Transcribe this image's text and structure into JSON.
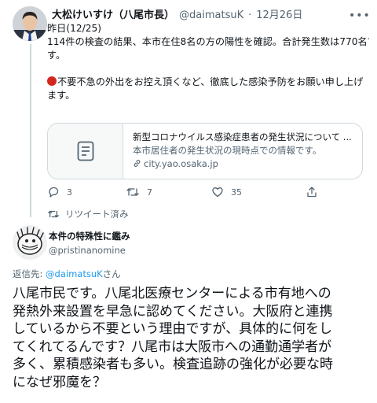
{
  "tweet": {
    "author_name": "大松けいすけ（八尾市長）",
    "author_handle": "@daimatsuK",
    "separator": "·",
    "date": "12月26日",
    "body_lines": [
      "昨日(12/25)",
      "114件の検査の結果、本市在住8名の方の陽性を確認。合計発生数は770名で",
      "す。",
      "",
      "不要不急の外出をお控え頂くなど、徹底した感染予防をお願い申し上げ",
      "ます。"
    ],
    "card": {
      "title": "新型コロナウイルス感染症患者の発生状況について ...",
      "description": "本市居住者の発生状況の現時点での情報です。",
      "domain": "city.yao.osaka.jp"
    },
    "stats": {
      "replies": "3",
      "retweets": "7",
      "likes": "35"
    }
  },
  "retweeted_label": "リツイート済み",
  "reply": {
    "author_name": "本件の特殊性に鑑み",
    "author_handle": "@pristinanomine",
    "reply_to_prefix": "返信先: ",
    "reply_to_handle": "@daimatsuK",
    "reply_to_suffix": "さん",
    "body_lines": [
      "八尾市民です。八尾北医療センターによる市有地への",
      "発熱外来設置を早急に認めてください。大阪府と連携",
      "しているから不要という理由ですが、具体的に何をし",
      "てくれてるんです？八尾市は大阪市への通勤通学者が",
      "多く、累積感染者も多い。検査追跡の強化が必要な時",
      "になぜ邪魔を？"
    ]
  },
  "colors": {
    "accent": "#1d9bf0",
    "muted": "#536471",
    "border": "#cfd9de",
    "red_dot": "#d42620"
  }
}
